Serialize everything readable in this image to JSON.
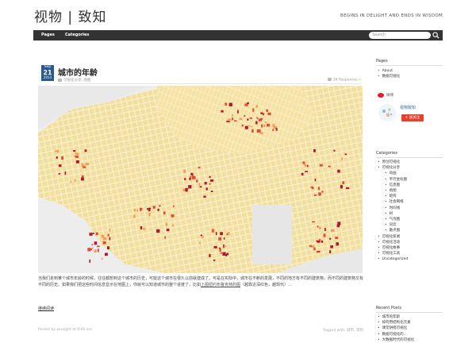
{
  "site": {
    "title": "视物 | 致知",
    "tagline": "BEGINS IN DELIGHT AND ENDS IN WISDOM"
  },
  "nav": {
    "items": [
      "Pages",
      "Categories"
    ],
    "search_placeholder": "Search"
  },
  "post": {
    "date": {
      "month": "Sep",
      "day": "21",
      "year": "2013"
    },
    "title": "城市的年龄",
    "categories": "可视化分享, 地图",
    "comments": "16 Responses »",
    "excerpt_main": "当我们走到某个城市年龄的时候，往往都想到这个城市的历史，可能这个城市在很久以前就建成了。可是在实际中，城市在不断的发展，不同的地方有不同的建筑物，而不同的建筑物又有不同的历史。如果我们把这些时间信息显示在地图上，你就可以知道城市的整个进度了，比如",
    "excerpt_link": "上图纽约布鲁克林的图",
    "excerpt_end": "（越靠近深红色，越现代）…",
    "read_more": "继续阅读",
    "meta": "Posted by wizsight at 9:00 am",
    "tags": "Tagged with: 城市, 得到"
  },
  "sidebar": {
    "pages_title": "Pages",
    "pages": [
      "About",
      "数据可视化"
    ],
    "weibo": {
      "label": "微博",
      "name": "视物致知",
      "follow": "+ 加关注"
    },
    "categories_title": "Categories",
    "categories": [
      {
        "label": "原创可视化",
        "sub": false
      },
      {
        "label": "可视化分享",
        "sub": false
      },
      {
        "label": "动画",
        "sub": true
      },
      {
        "label": "平行坐标图",
        "sub": true
      },
      {
        "label": "信息图",
        "sub": true
      },
      {
        "label": "地图",
        "sub": true
      },
      {
        "label": "矩阵",
        "sub": true
      },
      {
        "label": "社会网络",
        "sub": true
      },
      {
        "label": "时间线",
        "sub": true
      },
      {
        "label": "树",
        "sub": true
      },
      {
        "label": "气泡图",
        "sub": true
      },
      {
        "label": "词云",
        "sub": true
      },
      {
        "label": "散点图",
        "sub": true
      },
      {
        "label": "可视化新闻",
        "sub": false
      },
      {
        "label": "可视化活动",
        "sub": false
      },
      {
        "label": "可视化故事",
        "sub": false
      },
      {
        "label": "可视化工具",
        "sub": false
      },
      {
        "label": "Uncategorized",
        "sub": false
      }
    ],
    "recent_title": "Recent Posts",
    "recent": [
      "城市的年龄",
      "如何用结构化元素",
      "课堂讲授可视化",
      "数据可视化的...",
      "大数据时代的可视化"
    ]
  },
  "colors": {
    "nav_bg": "#333333",
    "date_badge": "#2a5a8c",
    "follow": "#e5412d"
  }
}
